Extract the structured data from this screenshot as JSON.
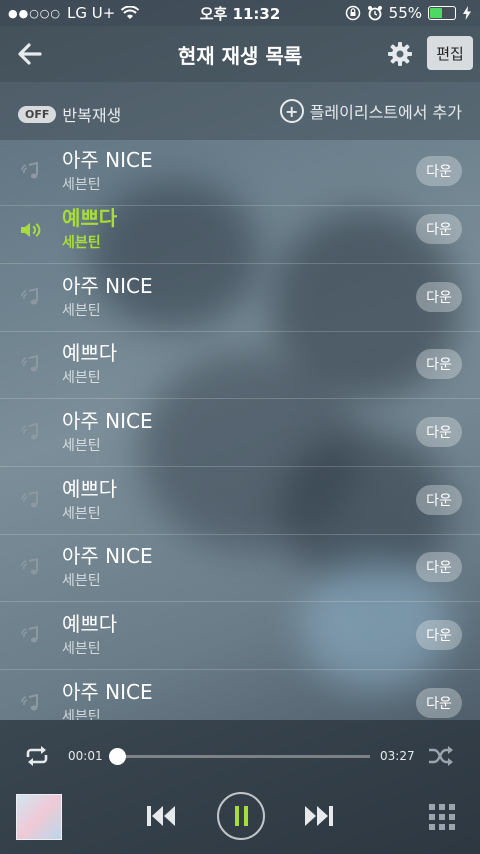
{
  "status_bar": {
    "carrier": "LG U+",
    "time": "오후 11:32",
    "battery_percent": "55%",
    "battery_level": 0.55,
    "signal_dots": "●●○○○"
  },
  "header": {
    "title": "현재 재생 목록",
    "edit_label": "편집"
  },
  "options": {
    "repeat_state": "OFF",
    "repeat_label": "반복재생",
    "add_playlist_label": "플레이리스트에서 추가"
  },
  "tracks": [
    {
      "title": "아주 NICE",
      "artist": "세븐틴",
      "action": "다운"
    },
    {
      "title": "예쁘다",
      "artist": "세븐틴",
      "action": "다운",
      "playing": true
    },
    {
      "title": "아주 NICE",
      "artist": "세븐틴",
      "action": "다운"
    },
    {
      "title": "예쁘다",
      "artist": "세븐틴",
      "action": "다운"
    },
    {
      "title": "아주 NICE",
      "artist": "세븐틴",
      "action": "다운"
    },
    {
      "title": "예쁘다",
      "artist": "세븐틴",
      "action": "다운"
    },
    {
      "title": "아주 NICE",
      "artist": "세븐틴",
      "action": "다운"
    },
    {
      "title": "예쁘다",
      "artist": "세븐틴",
      "action": "다운"
    },
    {
      "title": "아주 NICE",
      "artist": "세븐틴",
      "action": "다운"
    }
  ],
  "player": {
    "current_time": "00:01",
    "total_time": "03:27",
    "progress": 0.005
  },
  "colors": {
    "accent": "#a8dc3a",
    "battery": "#4cd964"
  }
}
